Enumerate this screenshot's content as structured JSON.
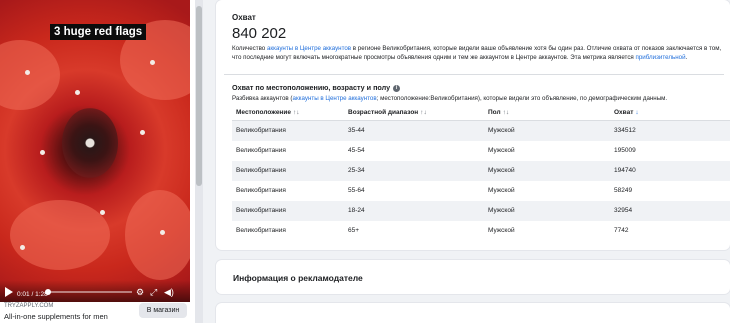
{
  "ad_preview": {
    "caption": "3 huge red flags",
    "time": "0:01 / 1:28",
    "progress": 0.02,
    "domain": "TRYZAPPLY.COM",
    "headline": "All-in-one supplements for men",
    "cta_label": "В магазин"
  },
  "reach": {
    "title": "Охват",
    "value": "840 202",
    "desc_part1": "Количество ",
    "desc_link1": "аккаунты в Центре аккаунтов",
    "desc_part2": " в регионе Великобритания, которые видели ваше объявление хотя бы один раз. Отличие охвата от показов заключается в том, что последние могут включать многократные просмотры объявления одним и тем же аккаунтом в Центре аккаунтов. Эта метрика является ",
    "desc_link2": "приблизительной",
    "desc_part3": "."
  },
  "breakdown": {
    "title": "Охват по местоположению, возрасту и полу",
    "info_icon": "i",
    "desc_part1": "Разбивка аккаунтов (",
    "desc_link": "аккаунты в Центре аккаунтов",
    "desc_part2": "; местоположение:Великобритания), которые видели это объявление, по демографическим данным."
  },
  "table": {
    "headers": [
      {
        "label": "Местоположение",
        "sort": "↑↓"
      },
      {
        "label": "Возрастной диапазон",
        "sort": "↑↓"
      },
      {
        "label": "Пол",
        "sort": "↑↓"
      },
      {
        "label": "Охват",
        "sort": "↓"
      }
    ],
    "rows": [
      [
        "Великобритания",
        "35-44",
        "Мужской",
        "334512"
      ],
      [
        "Великобритания",
        "45-54",
        "Мужской",
        "195009"
      ],
      [
        "Великобритания",
        "25-34",
        "Мужской",
        "194740"
      ],
      [
        "Великобритания",
        "55-64",
        "Мужской",
        "58249"
      ],
      [
        "Великобритания",
        "18-24",
        "Мужской",
        "32954"
      ],
      [
        "Великобритания",
        "65+",
        "Мужской",
        "7742"
      ]
    ]
  },
  "advertiser": {
    "title": "Информация о рекламодателе"
  },
  "colors": {
    "link": "#216fdb",
    "row_alt": "#f0f2f5",
    "page_bg": "#f0f2f5"
  }
}
